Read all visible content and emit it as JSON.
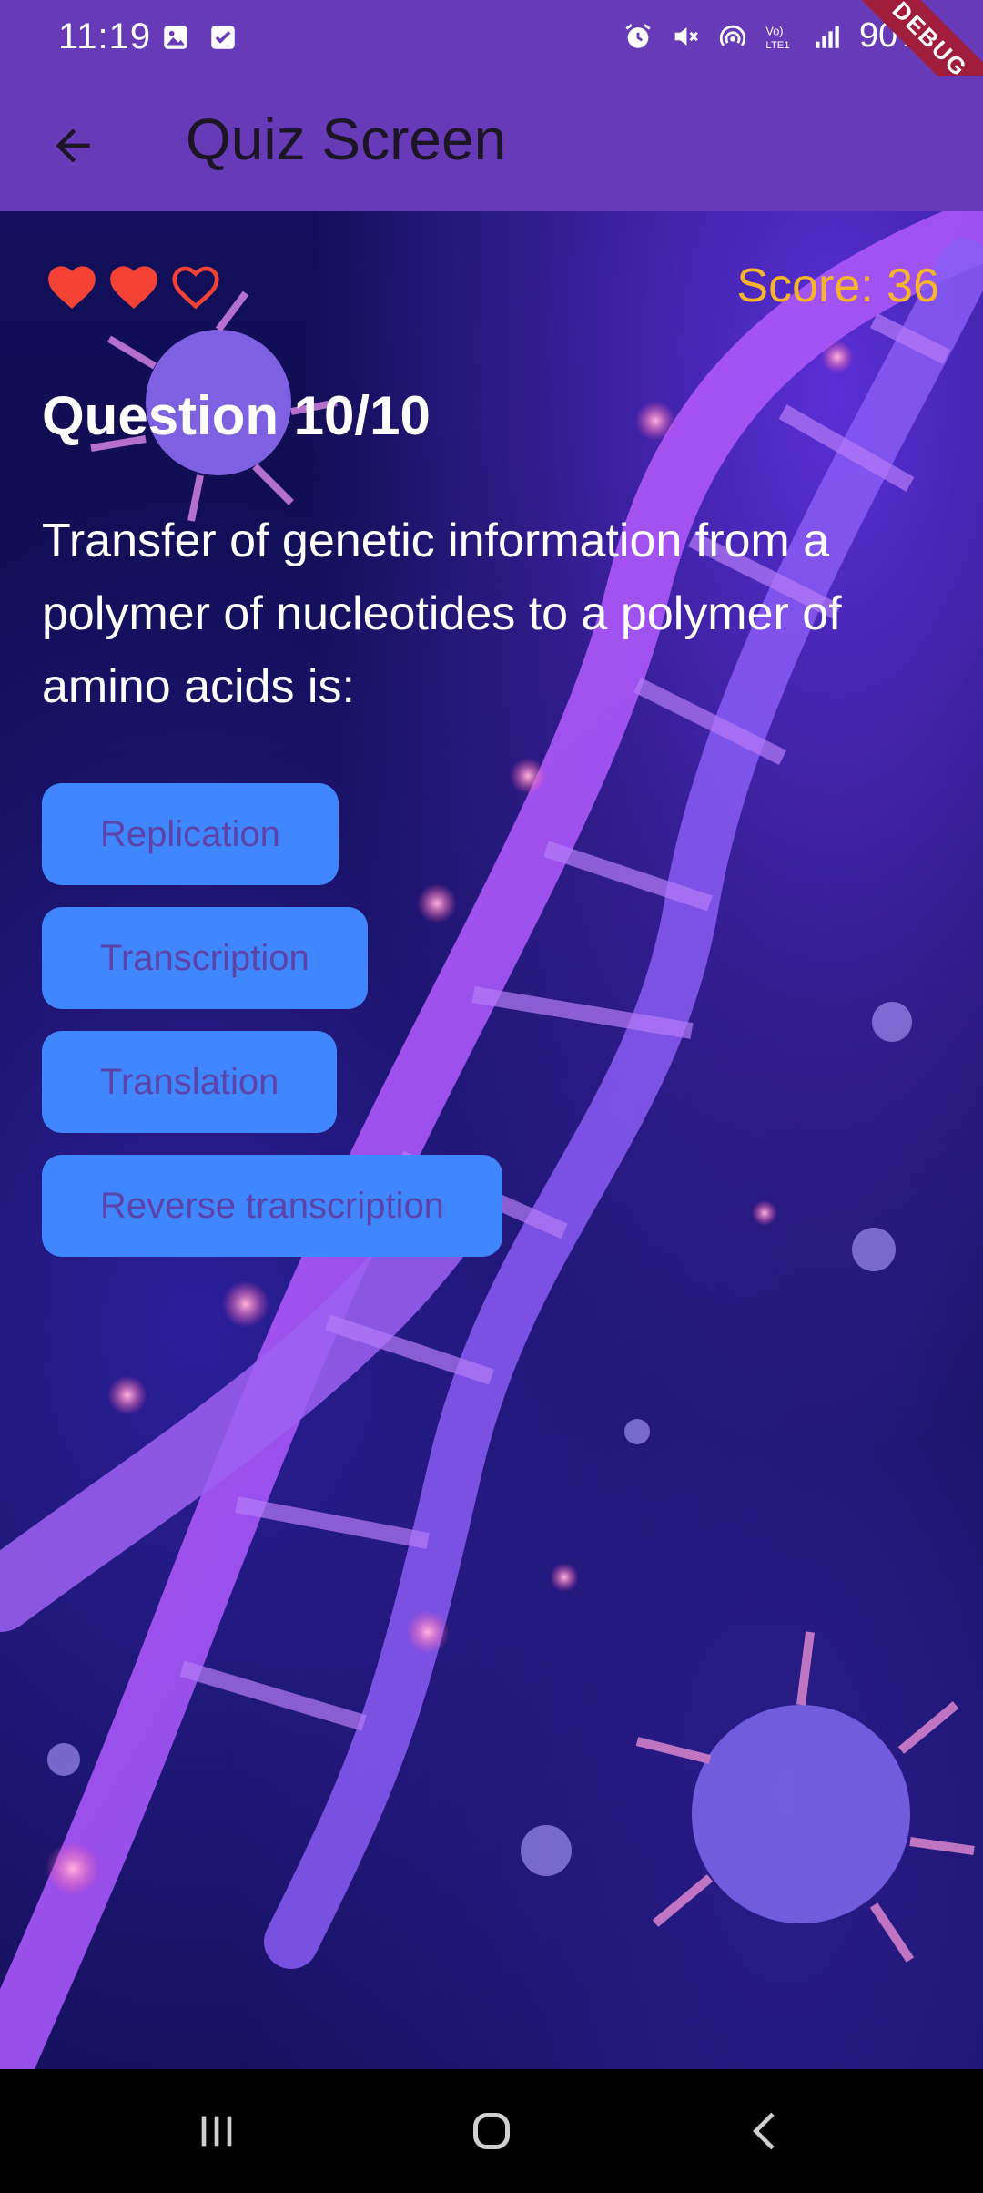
{
  "status_bar": {
    "time": "11:19",
    "battery": "90%",
    "debug_label": "DEBUG",
    "icons": [
      "gallery-icon",
      "checkbox-icon",
      "alarm-icon",
      "mute-icon",
      "hotspot-icon",
      "volte-icon",
      "signal-icon",
      "battery-icon"
    ]
  },
  "app_bar": {
    "title": "Quiz Screen",
    "back_icon": "arrow-back-icon"
  },
  "quiz": {
    "lives": {
      "total": 3,
      "remaining": 2
    },
    "score_label": "Score: 36",
    "question_number": "Question 10/10",
    "question_text": "Transfer of genetic information from a polymer of nucleotides to a polymer of amino acids is:",
    "options": [
      "Replication",
      "Transcription",
      "Translation",
      "Reverse transcription"
    ]
  },
  "colors": {
    "app_bar": "#673ab7",
    "score": "#f5b52a",
    "heart": "#f44336",
    "option_bg": "#3f86ff",
    "option_text": "#5d43a8"
  },
  "nav_bar": {
    "buttons": [
      "recent-apps-icon",
      "home-icon",
      "back-icon"
    ]
  }
}
